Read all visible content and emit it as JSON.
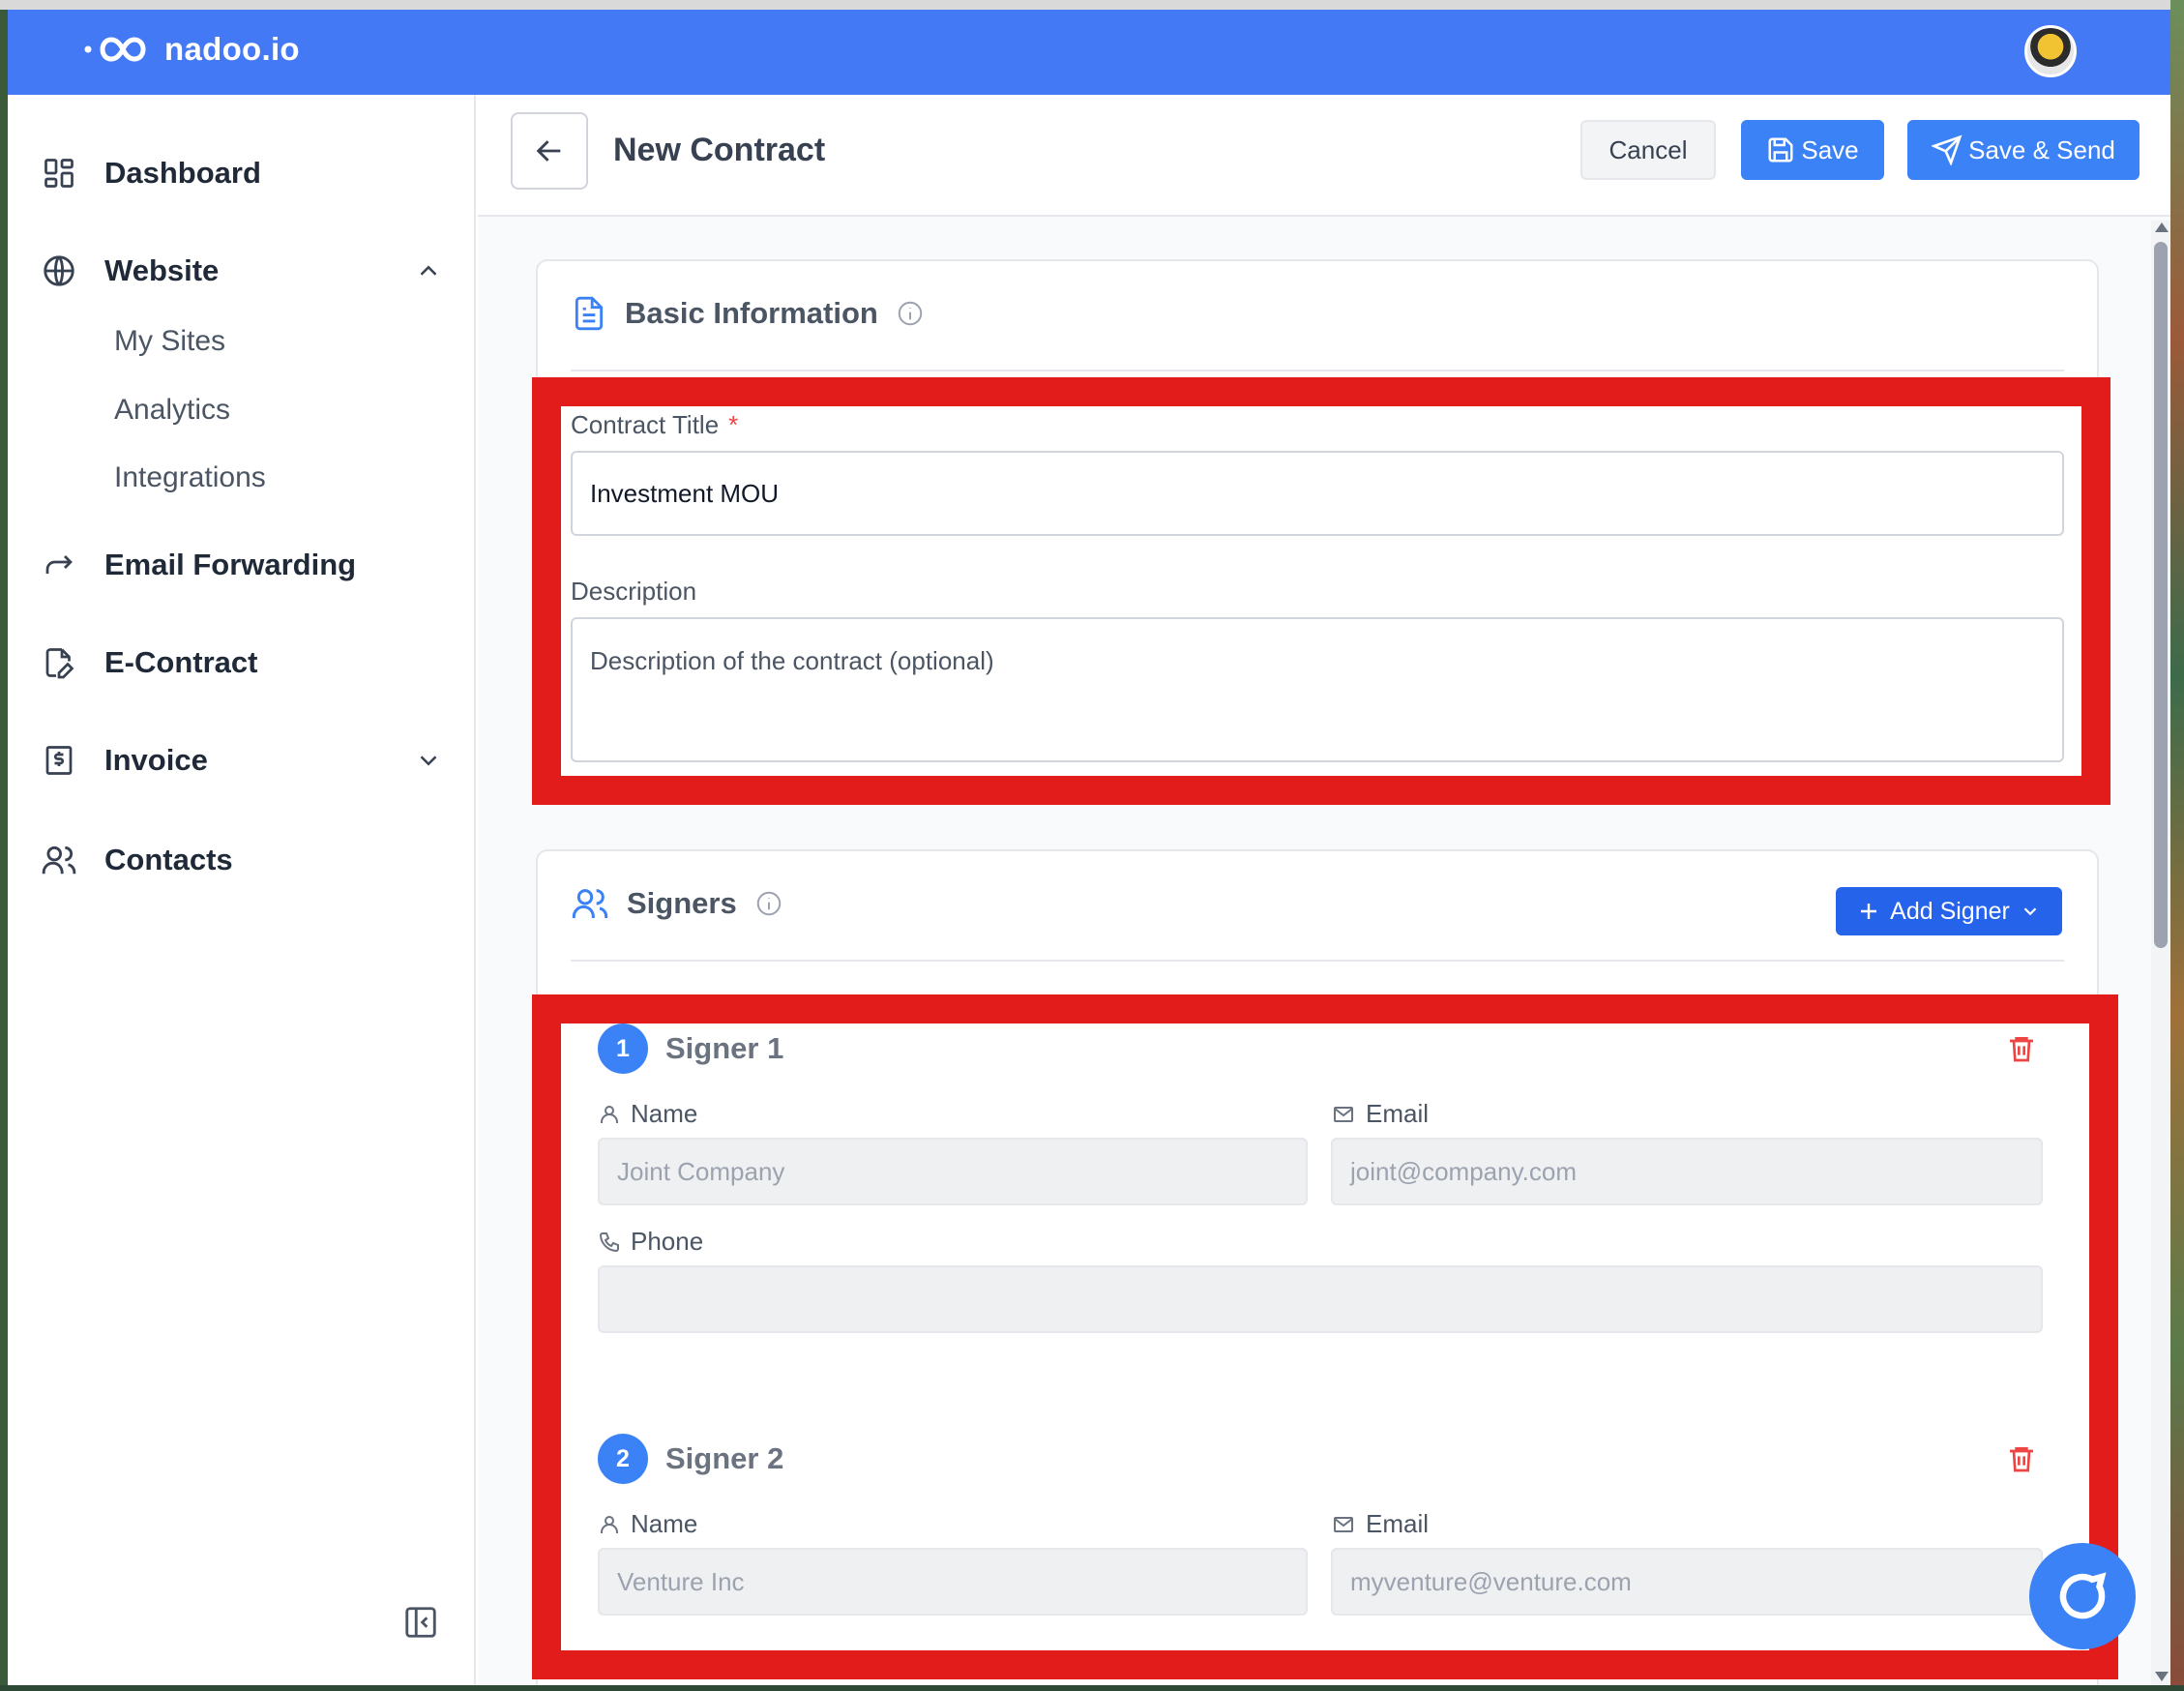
{
  "app": {
    "brand": "nadoo.io"
  },
  "sidebar": {
    "items": [
      {
        "label": "Dashboard",
        "icon": "dashboard-icon"
      },
      {
        "label": "Website",
        "icon": "globe-icon",
        "expanded": true,
        "children": [
          {
            "label": "My Sites"
          },
          {
            "label": "Analytics"
          },
          {
            "label": "Integrations"
          }
        ]
      },
      {
        "label": "Email Forwarding",
        "icon": "forward-icon"
      },
      {
        "label": "E-Contract",
        "icon": "contract-icon"
      },
      {
        "label": "Invoice",
        "icon": "invoice-icon",
        "expanded": false
      },
      {
        "label": "Contacts",
        "icon": "contacts-icon"
      }
    ]
  },
  "header": {
    "title": "New Contract",
    "cancel_label": "Cancel",
    "save_label": "Save",
    "send_label": "Save & Send"
  },
  "basic_info": {
    "title": "Basic Information",
    "contract_title_label": "Contract Title",
    "required_mark": "*",
    "contract_title_value": "Investment MOU",
    "description_label": "Description",
    "description_placeholder": "Description of the contract (optional)"
  },
  "signers": {
    "title": "Signers",
    "add_label": "Add Signer",
    "name_label": "Name",
    "email_label": "Email",
    "phone_label": "Phone",
    "list": [
      {
        "number": "1",
        "title": "Signer 1",
        "name": "Joint Company",
        "email": "joint@company.com",
        "phone": ""
      },
      {
        "number": "2",
        "title": "Signer 2",
        "name": "Venture Inc",
        "email": "myventure@venture.com"
      }
    ]
  },
  "colors": {
    "header_bg": "#4479f6",
    "primary": "#3b82f6",
    "highlight": "#e21b1b",
    "danger": "#ef4444"
  }
}
